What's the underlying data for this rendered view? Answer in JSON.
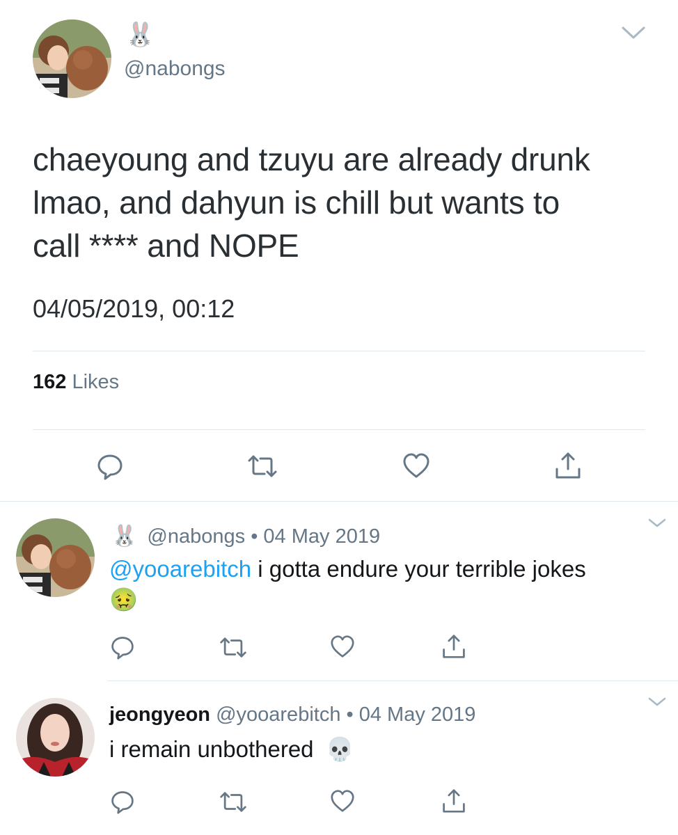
{
  "main_tweet": {
    "author_name_emoji": "🐰",
    "handle": "@nabongs",
    "text_lines": [
      "chaeyoung and tzuyu are already drunk",
      "lmao, and dahyun is chill but wants to",
      "call **** and NOPE"
    ],
    "timestamp": "04/05/2019, 00:12",
    "likes_count": "162",
    "likes_label": "Likes"
  },
  "replies": [
    {
      "author_name_emoji": "🐰",
      "handle": "@nabongs",
      "separator": "•",
      "date": "04 May 2019",
      "mention": "@yooarebitch",
      "text": "i gotta endure your terrible jokes",
      "trailing_emoji": "🤢"
    },
    {
      "author_name": "jeongyeon",
      "handle": "@yooarebitch",
      "separator": "•",
      "date": "04 May 2019",
      "text": "i remain unbothered",
      "trailing_emoji": "💀"
    }
  ],
  "icons": {
    "reply": "reply-icon",
    "retweet": "retweet-icon",
    "like": "heart-icon",
    "share": "share-icon",
    "menu": "chevron-down-icon"
  },
  "colors": {
    "link": "#1da1f2",
    "meta": "#657786",
    "text": "#14171a",
    "divider": "#e1e8ed",
    "icon": "#657786"
  }
}
